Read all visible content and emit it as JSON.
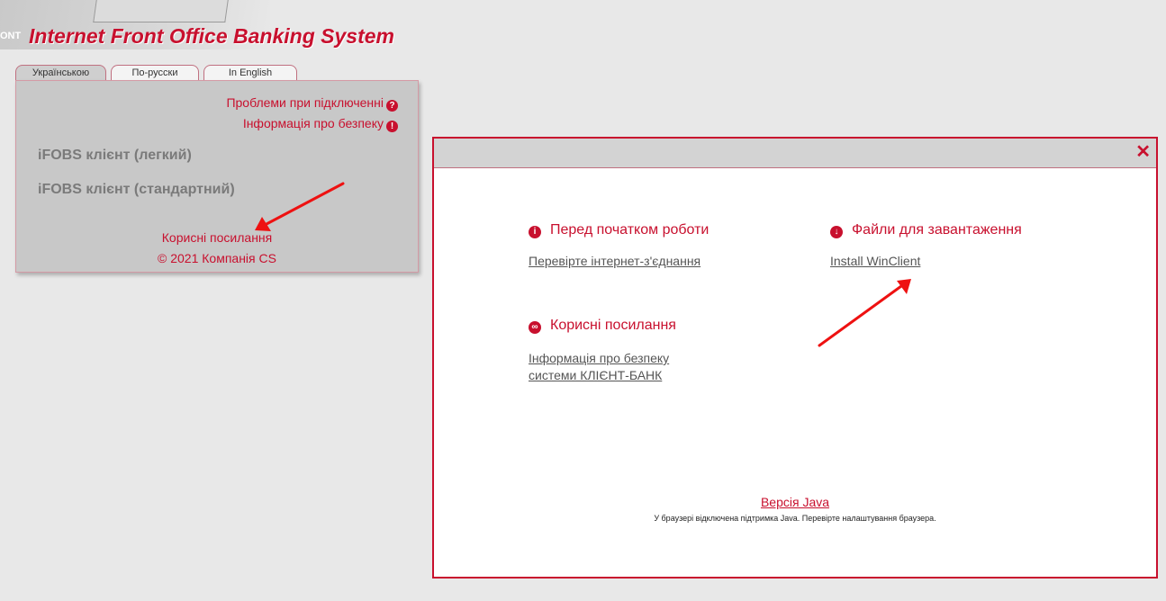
{
  "app": {
    "title": "Internet Front Office Banking System",
    "logo_fragment": "ONT"
  },
  "language_tabs": [
    {
      "label": "Українською",
      "active": true
    },
    {
      "label": "По-русски",
      "active": false
    },
    {
      "label": "In English",
      "active": false
    }
  ],
  "login_panel": {
    "problems_link": "Проблеми при підключенні",
    "security_link": "Інформація про безпеку",
    "client_light": "iFOBS клієнт (легкий)",
    "client_standard": "iFOBS клієнт (стандартний)",
    "useful_links": "Корисні посилання",
    "copyright": "© 2021 Компанія CS"
  },
  "modal": {
    "close_label": "✕",
    "before_start": {
      "heading": "Перед початком роботи",
      "link": "Перевірте інтернет-з'єднання"
    },
    "downloads": {
      "heading": "Файли для завантаження",
      "link": "Install WinClient"
    },
    "useful_links": {
      "heading": "Корисні посилання",
      "link_line1": "Інформація про безпеку",
      "link_line2": "системи КЛІЄНТ-БАНК"
    },
    "java_link": "Версія Java",
    "java_note": "У браузері відключена підтримка Java. Перевірте налаштування браузера."
  },
  "colors": {
    "accent": "#c8102e",
    "panel_bg": "#c8c8c8",
    "page_bg": "#e8e8e8",
    "annotation_arrow": "#ee1111"
  }
}
